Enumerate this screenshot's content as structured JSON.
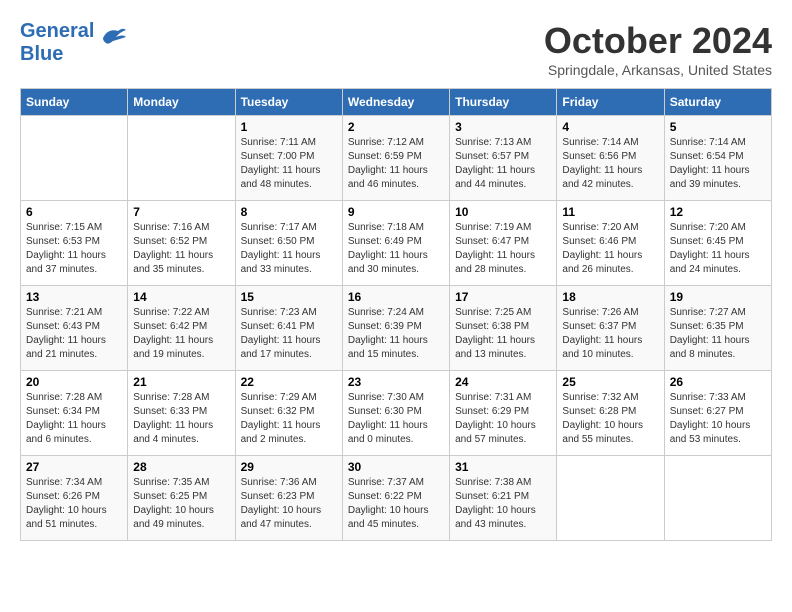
{
  "header": {
    "logo_line1": "General",
    "logo_line2": "Blue",
    "month_title": "October 2024",
    "subtitle": "Springdale, Arkansas, United States"
  },
  "weekdays": [
    "Sunday",
    "Monday",
    "Tuesday",
    "Wednesday",
    "Thursday",
    "Friday",
    "Saturday"
  ],
  "weeks": [
    [
      {
        "day": "",
        "info": ""
      },
      {
        "day": "",
        "info": ""
      },
      {
        "day": "1",
        "info": "Sunrise: 7:11 AM\nSunset: 7:00 PM\nDaylight: 11 hours and 48 minutes."
      },
      {
        "day": "2",
        "info": "Sunrise: 7:12 AM\nSunset: 6:59 PM\nDaylight: 11 hours and 46 minutes."
      },
      {
        "day": "3",
        "info": "Sunrise: 7:13 AM\nSunset: 6:57 PM\nDaylight: 11 hours and 44 minutes."
      },
      {
        "day": "4",
        "info": "Sunrise: 7:14 AM\nSunset: 6:56 PM\nDaylight: 11 hours and 42 minutes."
      },
      {
        "day": "5",
        "info": "Sunrise: 7:14 AM\nSunset: 6:54 PM\nDaylight: 11 hours and 39 minutes."
      }
    ],
    [
      {
        "day": "6",
        "info": "Sunrise: 7:15 AM\nSunset: 6:53 PM\nDaylight: 11 hours and 37 minutes."
      },
      {
        "day": "7",
        "info": "Sunrise: 7:16 AM\nSunset: 6:52 PM\nDaylight: 11 hours and 35 minutes."
      },
      {
        "day": "8",
        "info": "Sunrise: 7:17 AM\nSunset: 6:50 PM\nDaylight: 11 hours and 33 minutes."
      },
      {
        "day": "9",
        "info": "Sunrise: 7:18 AM\nSunset: 6:49 PM\nDaylight: 11 hours and 30 minutes."
      },
      {
        "day": "10",
        "info": "Sunrise: 7:19 AM\nSunset: 6:47 PM\nDaylight: 11 hours and 28 minutes."
      },
      {
        "day": "11",
        "info": "Sunrise: 7:20 AM\nSunset: 6:46 PM\nDaylight: 11 hours and 26 minutes."
      },
      {
        "day": "12",
        "info": "Sunrise: 7:20 AM\nSunset: 6:45 PM\nDaylight: 11 hours and 24 minutes."
      }
    ],
    [
      {
        "day": "13",
        "info": "Sunrise: 7:21 AM\nSunset: 6:43 PM\nDaylight: 11 hours and 21 minutes."
      },
      {
        "day": "14",
        "info": "Sunrise: 7:22 AM\nSunset: 6:42 PM\nDaylight: 11 hours and 19 minutes."
      },
      {
        "day": "15",
        "info": "Sunrise: 7:23 AM\nSunset: 6:41 PM\nDaylight: 11 hours and 17 minutes."
      },
      {
        "day": "16",
        "info": "Sunrise: 7:24 AM\nSunset: 6:39 PM\nDaylight: 11 hours and 15 minutes."
      },
      {
        "day": "17",
        "info": "Sunrise: 7:25 AM\nSunset: 6:38 PM\nDaylight: 11 hours and 13 minutes."
      },
      {
        "day": "18",
        "info": "Sunrise: 7:26 AM\nSunset: 6:37 PM\nDaylight: 11 hours and 10 minutes."
      },
      {
        "day": "19",
        "info": "Sunrise: 7:27 AM\nSunset: 6:35 PM\nDaylight: 11 hours and 8 minutes."
      }
    ],
    [
      {
        "day": "20",
        "info": "Sunrise: 7:28 AM\nSunset: 6:34 PM\nDaylight: 11 hours and 6 minutes."
      },
      {
        "day": "21",
        "info": "Sunrise: 7:28 AM\nSunset: 6:33 PM\nDaylight: 11 hours and 4 minutes."
      },
      {
        "day": "22",
        "info": "Sunrise: 7:29 AM\nSunset: 6:32 PM\nDaylight: 11 hours and 2 minutes."
      },
      {
        "day": "23",
        "info": "Sunrise: 7:30 AM\nSunset: 6:30 PM\nDaylight: 11 hours and 0 minutes."
      },
      {
        "day": "24",
        "info": "Sunrise: 7:31 AM\nSunset: 6:29 PM\nDaylight: 10 hours and 57 minutes."
      },
      {
        "day": "25",
        "info": "Sunrise: 7:32 AM\nSunset: 6:28 PM\nDaylight: 10 hours and 55 minutes."
      },
      {
        "day": "26",
        "info": "Sunrise: 7:33 AM\nSunset: 6:27 PM\nDaylight: 10 hours and 53 minutes."
      }
    ],
    [
      {
        "day": "27",
        "info": "Sunrise: 7:34 AM\nSunset: 6:26 PM\nDaylight: 10 hours and 51 minutes."
      },
      {
        "day": "28",
        "info": "Sunrise: 7:35 AM\nSunset: 6:25 PM\nDaylight: 10 hours and 49 minutes."
      },
      {
        "day": "29",
        "info": "Sunrise: 7:36 AM\nSunset: 6:23 PM\nDaylight: 10 hours and 47 minutes."
      },
      {
        "day": "30",
        "info": "Sunrise: 7:37 AM\nSunset: 6:22 PM\nDaylight: 10 hours and 45 minutes."
      },
      {
        "day": "31",
        "info": "Sunrise: 7:38 AM\nSunset: 6:21 PM\nDaylight: 10 hours and 43 minutes."
      },
      {
        "day": "",
        "info": ""
      },
      {
        "day": "",
        "info": ""
      }
    ]
  ]
}
